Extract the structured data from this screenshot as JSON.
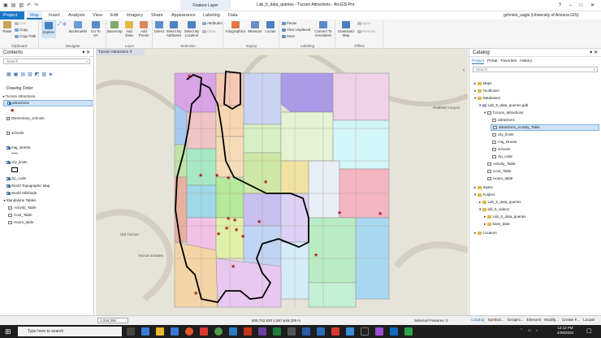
{
  "window": {
    "title": "Lab_5_data_queries - Tucson Attractions - ArcGIS Pro",
    "context_tab": "Feature Layer",
    "user": "gchristo_uagis (University of Arizona GIS)"
  },
  "ribbon_tabs": [
    "Project",
    "Map",
    "Insert",
    "Analysis",
    "View",
    "Edit",
    "Imagery",
    "Share",
    "Appearance",
    "Labeling",
    "Data"
  ],
  "clipboard": {
    "cut": "Cut",
    "copy": "Copy",
    "copy_path": "Copy Path",
    "paste": "Paste",
    "label": "Clipboard"
  },
  "navigate": {
    "explore": "Explore",
    "bookmarks": "Bookmarks",
    "goto": "Go To XY",
    "label": "Navigate"
  },
  "layer": {
    "basemap": "Basemap",
    "add_data": "Add Data",
    "add_preset": "Add Preset",
    "label": "Layer"
  },
  "selection": {
    "select": "Select",
    "by_attr": "Select By Attributes",
    "by_loc": "Select By Location",
    "attributes": "Attributes",
    "clear": "Clear",
    "label": "Selection"
  },
  "inquiry": {
    "infographics": "Infographics",
    "measure": "Measure",
    "locate": "Locate",
    "label": "Inquiry"
  },
  "labeling": {
    "pause": "Pause",
    "view_unplaced": "View Unplaced",
    "more": "More",
    "convert": "Convert To Annotation",
    "label": "Labeling"
  },
  "offline": {
    "download": "Download Map",
    "sync": "Sync",
    "remove": "Remove",
    "label": "Offline"
  },
  "contents": {
    "title": "Contents",
    "search_placeholder": "Search",
    "drawing_order": "Drawing Order",
    "layers": [
      {
        "name": "Tucson Attractions",
        "checked": true
      },
      {
        "name": "attractions",
        "checked": true
      },
      {
        "name": "Elementary_schools",
        "checked": false
      },
      {
        "name": "schools",
        "checked": false
      },
      {
        "name": "maj_streets",
        "checked": true
      },
      {
        "name": "city_limits",
        "checked": true
      },
      {
        "name": "zip_code",
        "checked": true
      },
      {
        "name": "World Topographic Map",
        "checked": true
      },
      {
        "name": "World Hillshade",
        "checked": true
      }
    ],
    "standalone": "Standalone Tables",
    "tables": [
      "Activity_Table",
      "Cost_Table",
      "Hours_table"
    ]
  },
  "map": {
    "tab": "Tucson Attractions",
    "label_oldtucson": "Old Tucson",
    "label_tucson": "Tucson Estates",
    "label_redfield": "Redfield Canyon",
    "scale": "1:234,355",
    "coords": "805,742,830 1,567,646.229 m",
    "selected": "Selected Features: 0"
  },
  "catalog": {
    "title": "Catalog",
    "tabs": [
      "Project",
      "Portal",
      "Favorites",
      "History"
    ],
    "search_placeholder": "Search",
    "items": [
      "Maps",
      "Toolboxes",
      "Databases",
      "Lab_5_data_queries.gdb",
      "Tucson_attractions",
      "attractions",
      "attractions_Activity_Table",
      "city_limits",
      "maj_streets",
      "schools",
      "zip_code",
      "Activity_Table",
      "Cost_Table",
      "Hours_table",
      "Styles",
      "Folders",
      "Lab_5_data_queries",
      "lab_5_videos",
      "Lab_5_data_queries",
      "base_data",
      "Locators"
    ]
  },
  "bottom_tabs": [
    "Catalog",
    "Symbol...",
    "Geopro...",
    "Element",
    "Modify...",
    "Create F...",
    "Locate"
  ],
  "taskbar": {
    "search": "Type here to search",
    "time": "12:12 PM",
    "date": "4/29/2020"
  },
  "colors": {
    "accent": "#1976c8",
    "selection": "#cde3f7"
  }
}
